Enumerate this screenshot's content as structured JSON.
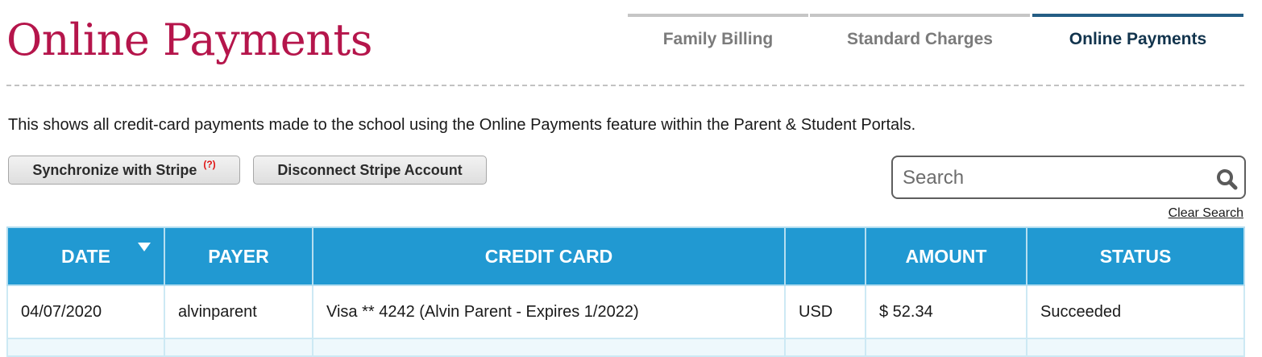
{
  "page": {
    "title": "Online Payments",
    "description": "This shows all credit-card payments made to the school using the Online Payments feature within the Parent & Student Portals."
  },
  "tabs": [
    {
      "label": "Family Billing",
      "active": false
    },
    {
      "label": "Standard Charges",
      "active": false
    },
    {
      "label": "Online Payments",
      "active": true
    }
  ],
  "toolbar": {
    "sync_label": "Synchronize with Stripe",
    "sync_help": "(?)",
    "disconnect_label": "Disconnect Stripe Account"
  },
  "search": {
    "placeholder": "Search",
    "value": "",
    "icon": "magnifier-icon",
    "clear_label": "Clear Search"
  },
  "table": {
    "columns": [
      "DATE",
      "PAYER",
      "CREDIT CARD",
      "",
      "AMOUNT",
      "STATUS"
    ],
    "sorted_column": "DATE",
    "rows": [
      {
        "date": "04/07/2020",
        "payer": "alvinparent",
        "card": "Visa ** 4242 (Alvin Parent - Expires 1/2022)",
        "currency": "USD",
        "amount": "$ 52.34",
        "status": "Succeeded"
      }
    ]
  },
  "colors": {
    "title": "#b5154b",
    "header": "#2199d2",
    "active_tab": "#245d84",
    "help_mark": "#e01414"
  }
}
